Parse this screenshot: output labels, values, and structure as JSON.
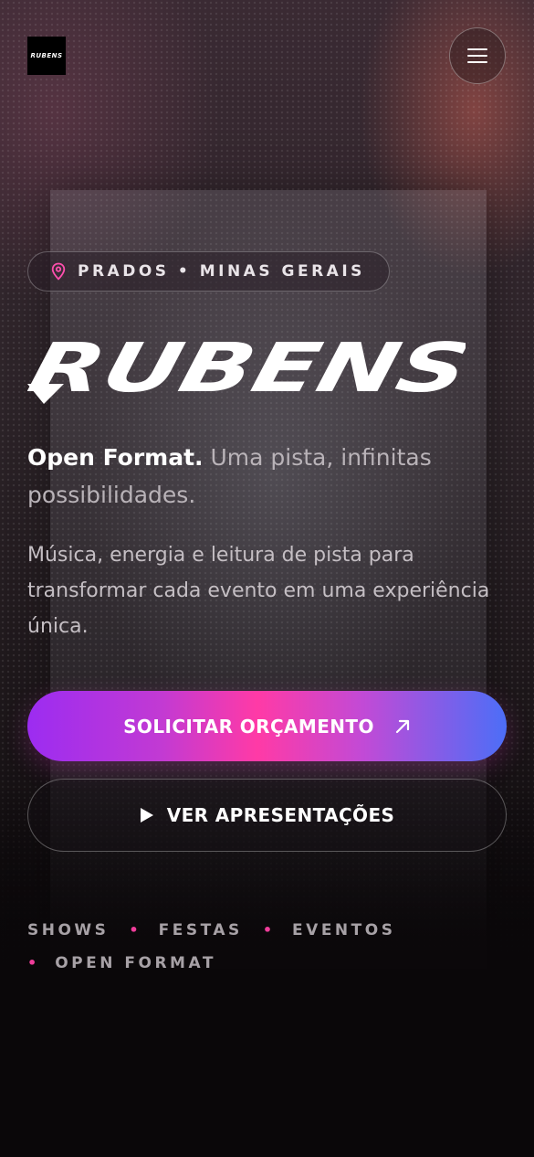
{
  "header": {
    "logo_text": "RUBENS",
    "menu_icon": "hamburger-menu-icon"
  },
  "hero": {
    "location": "PRADOS • MINAS GERAIS",
    "location_icon": "map-pin-icon",
    "brand_title": "RUBENS",
    "tagline_strong": "Open Format.",
    "tagline_rest": " Uma pista, infinitas possibilidades.",
    "description": "Música, energia e leitura de pista para transformar cada evento em uma experiência única.",
    "primary_cta": {
      "label": "SOLICITAR ORÇAMENTO",
      "icon": "arrow-up-right-icon"
    },
    "secondary_cta": {
      "label": "VER APRESENTAÇÕES",
      "icon": "play-icon"
    },
    "tags": [
      "SHOWS",
      "FESTAS",
      "EVENTOS",
      "OPEN FORMAT"
    ]
  },
  "colors": {
    "accent_pink": "#ff3aa6",
    "accent_purple": "#9c2cf1",
    "accent_blue": "#4c6ef7",
    "background": "#0a0709"
  }
}
